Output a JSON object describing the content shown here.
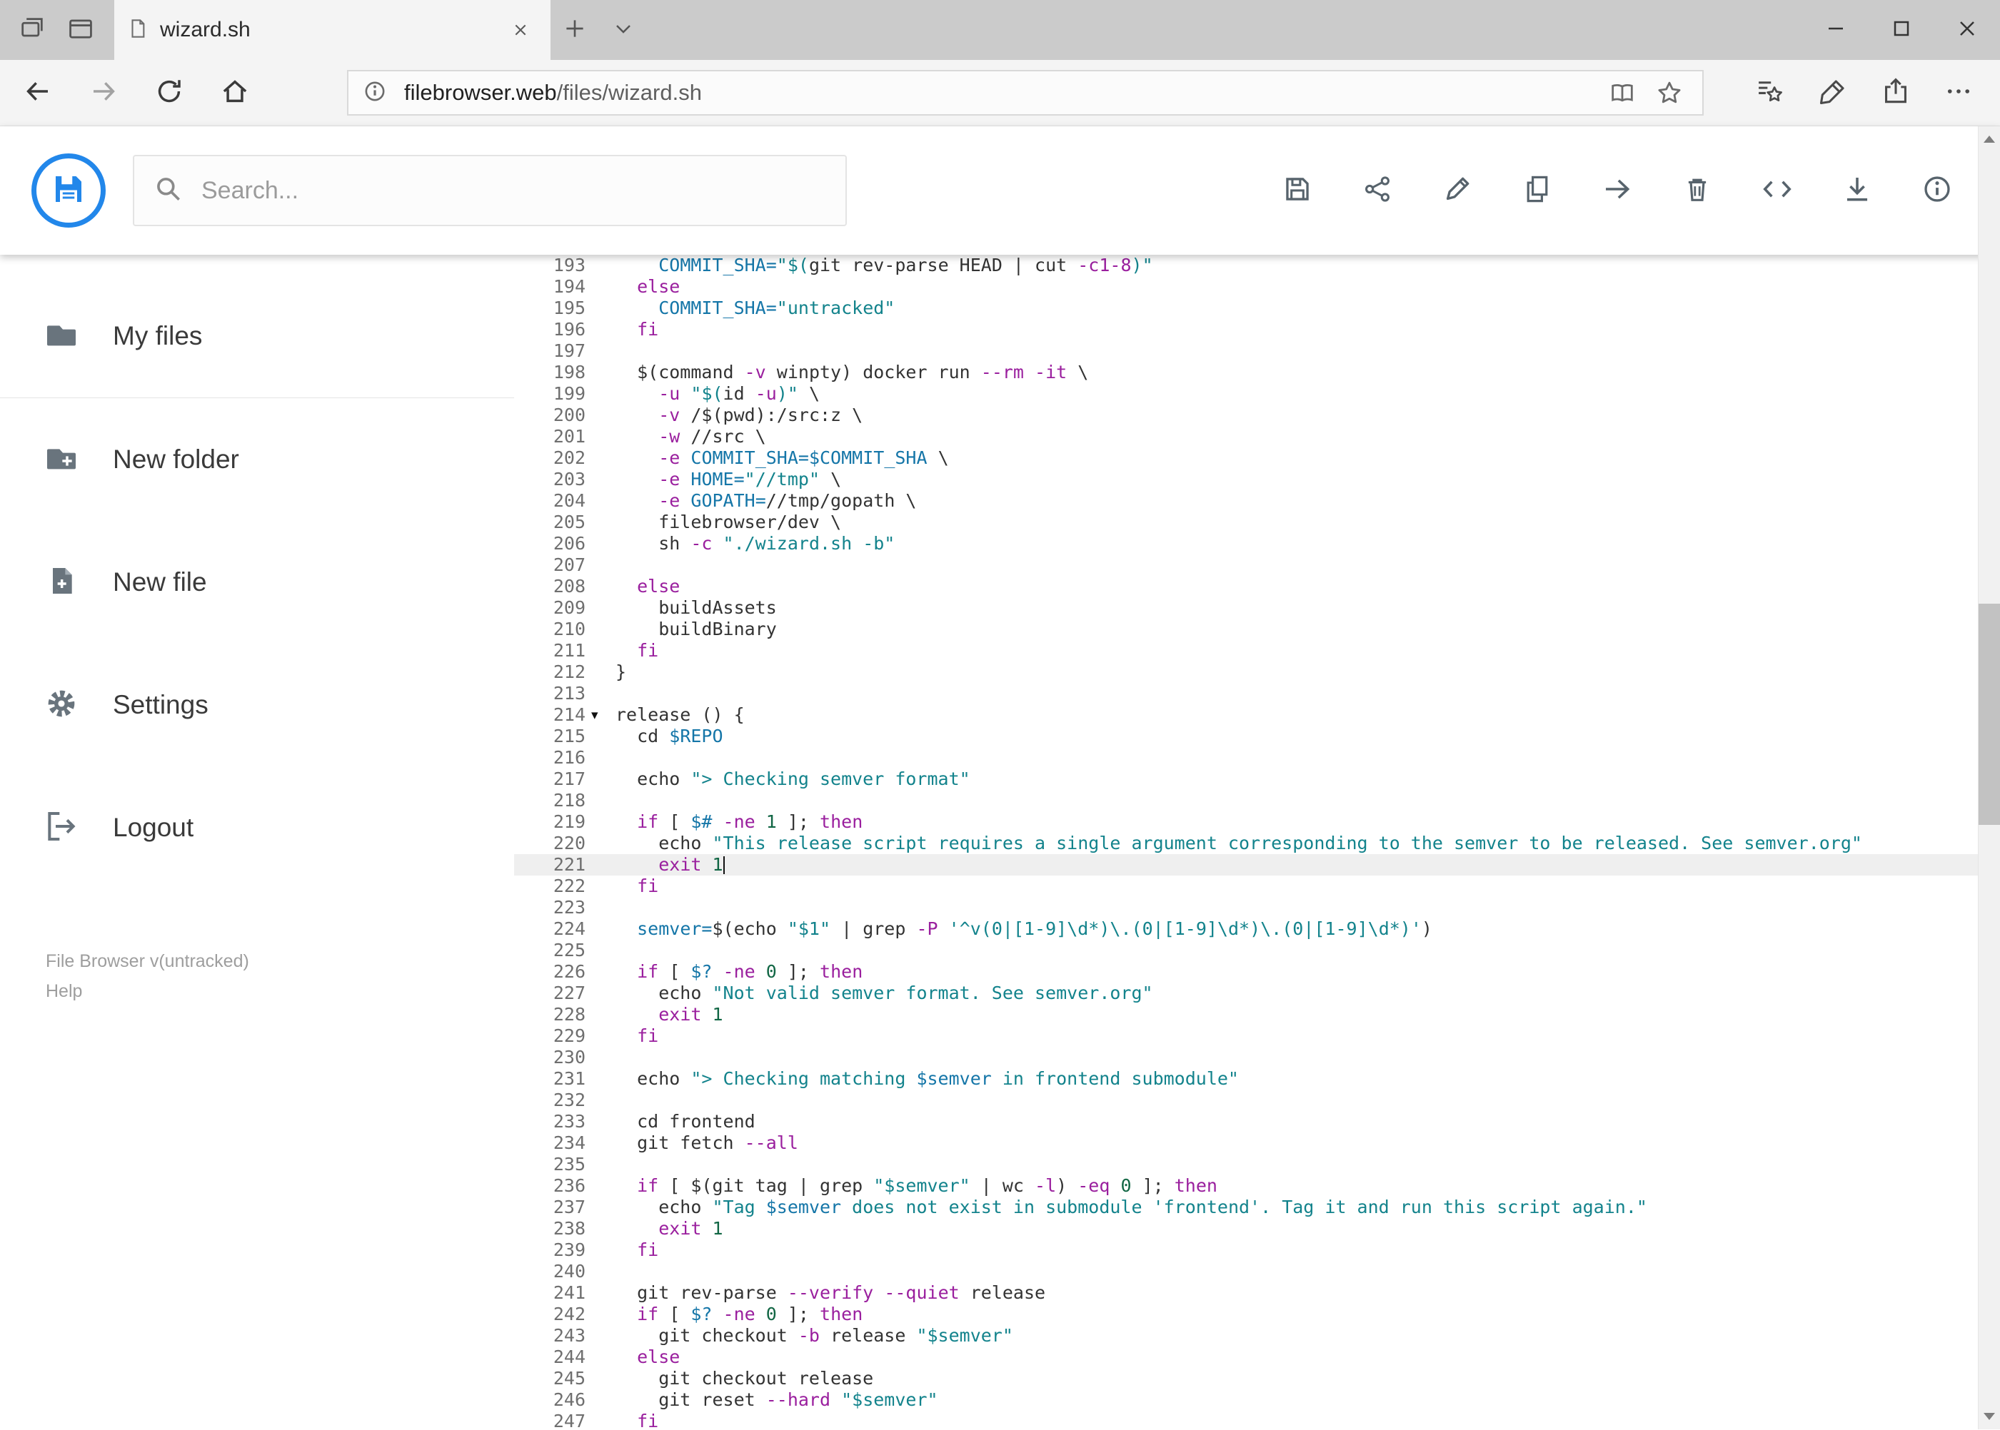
{
  "browser": {
    "tab_title": "wizard.sh",
    "url_domain": "filebrowser.web",
    "url_path": "/files/wizard.sh"
  },
  "header": {
    "search_placeholder": "Search..."
  },
  "sidebar": {
    "items": [
      {
        "label": "My files"
      },
      {
        "label": "New folder"
      },
      {
        "label": "New file"
      },
      {
        "label": "Settings"
      },
      {
        "label": "Logout"
      }
    ],
    "credits_title": "File Browser v(untracked)",
    "credits_help": "Help"
  },
  "colors": {
    "accent_blue": "#2287ea",
    "keyword": "#9a1f9e",
    "variable": "#1576a8",
    "string": "#13838c",
    "number": "#116644",
    "plain_code": "#333333",
    "active_line_bg": "#efefef"
  },
  "icons": {
    "toolbar": [
      "save-icon",
      "share-icon",
      "rename-icon",
      "copy-icon",
      "move-icon",
      "delete-icon",
      "code-icon",
      "download-icon",
      "info-icon"
    ],
    "sidebar": [
      "folder-icon",
      "new-folder-icon",
      "new-file-icon",
      "settings-icon",
      "logout-icon"
    ],
    "navbar": [
      "back-icon",
      "forward-icon",
      "refresh-icon",
      "home-icon",
      "info-circle-icon",
      "reading-view-icon",
      "star-icon",
      "hub-icon",
      "web-note-icon",
      "share-icon",
      "more-icon"
    ]
  },
  "editor": {
    "fold_marker": "▾",
    "active_line": 221,
    "lines": [
      {
        "n": 193,
        "t": [
          [
            "p",
            "    "
          ],
          [
            "v",
            "COMMIT_SHA="
          ],
          [
            "s",
            "\"$("
          ],
          [
            "p",
            "git rev-parse HEAD | cut "
          ],
          [
            "k",
            "-c1-8"
          ],
          [
            "s",
            ")\""
          ]
        ]
      },
      {
        "n": 194,
        "t": [
          [
            "p",
            "  "
          ],
          [
            "k",
            "else"
          ]
        ]
      },
      {
        "n": 195,
        "t": [
          [
            "p",
            "    "
          ],
          [
            "v",
            "COMMIT_SHA="
          ],
          [
            "s",
            "\"untracked\""
          ]
        ]
      },
      {
        "n": 196,
        "t": [
          [
            "p",
            "  "
          ],
          [
            "k",
            "fi"
          ]
        ]
      },
      {
        "n": 197,
        "t": [
          [
            "p",
            ""
          ]
        ]
      },
      {
        "n": 198,
        "t": [
          [
            "p",
            "  $(command "
          ],
          [
            "k",
            "-v"
          ],
          [
            "p",
            " winpty) docker run "
          ],
          [
            "k",
            "--rm"
          ],
          [
            "p",
            " "
          ],
          [
            "k",
            "-it"
          ],
          [
            "p",
            " \\"
          ]
        ]
      },
      {
        "n": 199,
        "t": [
          [
            "p",
            "    "
          ],
          [
            "k",
            "-u"
          ],
          [
            "p",
            " "
          ],
          [
            "s",
            "\"$("
          ],
          [
            "p",
            "id "
          ],
          [
            "k",
            "-u"
          ],
          [
            "s",
            ")\""
          ],
          [
            "p",
            " \\"
          ]
        ]
      },
      {
        "n": 200,
        "t": [
          [
            "p",
            "    "
          ],
          [
            "k",
            "-v"
          ],
          [
            "p",
            " /$(pwd):/src:z \\"
          ]
        ]
      },
      {
        "n": 201,
        "t": [
          [
            "p",
            "    "
          ],
          [
            "k",
            "-w"
          ],
          [
            "p",
            " //src \\"
          ]
        ]
      },
      {
        "n": 202,
        "t": [
          [
            "p",
            "    "
          ],
          [
            "k",
            "-e"
          ],
          [
            "p",
            " "
          ],
          [
            "v",
            "COMMIT_SHA=$COMMIT_SHA"
          ],
          [
            "p",
            " \\"
          ]
        ]
      },
      {
        "n": 203,
        "t": [
          [
            "p",
            "    "
          ],
          [
            "k",
            "-e"
          ],
          [
            "p",
            " "
          ],
          [
            "v",
            "HOME="
          ],
          [
            "s",
            "\"//tmp\""
          ],
          [
            "p",
            " \\"
          ]
        ]
      },
      {
        "n": 204,
        "t": [
          [
            "p",
            "    "
          ],
          [
            "k",
            "-e"
          ],
          [
            "p",
            " "
          ],
          [
            "v",
            "GOPATH="
          ],
          [
            "p",
            "//tmp/gopath \\"
          ]
        ]
      },
      {
        "n": 205,
        "t": [
          [
            "p",
            "    filebrowser/dev \\"
          ]
        ]
      },
      {
        "n": 206,
        "t": [
          [
            "p",
            "    sh "
          ],
          [
            "k",
            "-c"
          ],
          [
            "p",
            " "
          ],
          [
            "s",
            "\"./wizard.sh -b\""
          ]
        ]
      },
      {
        "n": 207,
        "t": [
          [
            "p",
            ""
          ]
        ]
      },
      {
        "n": 208,
        "t": [
          [
            "p",
            "  "
          ],
          [
            "k",
            "else"
          ]
        ]
      },
      {
        "n": 209,
        "t": [
          [
            "p",
            "    buildAssets"
          ]
        ]
      },
      {
        "n": 210,
        "t": [
          [
            "p",
            "    buildBinary"
          ]
        ]
      },
      {
        "n": 211,
        "t": [
          [
            "p",
            "  "
          ],
          [
            "k",
            "fi"
          ]
        ]
      },
      {
        "n": 212,
        "t": [
          [
            "p",
            "}"
          ]
        ]
      },
      {
        "n": 213,
        "t": [
          [
            "p",
            ""
          ]
        ]
      },
      {
        "n": 214,
        "fold": true,
        "t": [
          [
            "p",
            "release () {"
          ]
        ]
      },
      {
        "n": 215,
        "t": [
          [
            "p",
            "  cd "
          ],
          [
            "v",
            "$REPO"
          ]
        ]
      },
      {
        "n": 216,
        "t": [
          [
            "p",
            ""
          ]
        ]
      },
      {
        "n": 217,
        "t": [
          [
            "p",
            "  echo "
          ],
          [
            "s",
            "\"> Checking semver format\""
          ]
        ]
      },
      {
        "n": 218,
        "t": [
          [
            "p",
            ""
          ]
        ]
      },
      {
        "n": 219,
        "t": [
          [
            "p",
            "  "
          ],
          [
            "k",
            "if"
          ],
          [
            "p",
            " [ "
          ],
          [
            "v",
            "$#"
          ],
          [
            "p",
            " "
          ],
          [
            "k",
            "-ne"
          ],
          [
            "p",
            " "
          ],
          [
            "n",
            "1"
          ],
          [
            "p",
            " ]; "
          ],
          [
            "k",
            "then"
          ]
        ]
      },
      {
        "n": 220,
        "t": [
          [
            "p",
            "    echo "
          ],
          [
            "s",
            "\"This release script requires a single argument corresponding to the semver to be released. See semver.org\""
          ]
        ]
      },
      {
        "n": 221,
        "active": true,
        "cursor": true,
        "t": [
          [
            "p",
            "    "
          ],
          [
            "k",
            "exit"
          ],
          [
            "p",
            " "
          ],
          [
            "n",
            "1"
          ]
        ]
      },
      {
        "n": 222,
        "t": [
          [
            "p",
            "  "
          ],
          [
            "k",
            "fi"
          ]
        ]
      },
      {
        "n": 223,
        "t": [
          [
            "p",
            ""
          ]
        ]
      },
      {
        "n": 224,
        "t": [
          [
            "p",
            "  "
          ],
          [
            "v",
            "semver="
          ],
          [
            "p",
            "$(echo "
          ],
          [
            "s",
            "\"$1\""
          ],
          [
            "p",
            " | grep "
          ],
          [
            "k",
            "-P"
          ],
          [
            "p",
            " "
          ],
          [
            "s",
            "'^v(0|[1-9]\\d*)\\.(0|[1-9]\\d*)\\.(0|[1-9]\\d*)'"
          ],
          [
            "p",
            ")"
          ]
        ]
      },
      {
        "n": 225,
        "t": [
          [
            "p",
            ""
          ]
        ]
      },
      {
        "n": 226,
        "t": [
          [
            "p",
            "  "
          ],
          [
            "k",
            "if"
          ],
          [
            "p",
            " [ "
          ],
          [
            "v",
            "$?"
          ],
          [
            "p",
            " "
          ],
          [
            "k",
            "-ne"
          ],
          [
            "p",
            " "
          ],
          [
            "n",
            "0"
          ],
          [
            "p",
            " ]; "
          ],
          [
            "k",
            "then"
          ]
        ]
      },
      {
        "n": 227,
        "t": [
          [
            "p",
            "    echo "
          ],
          [
            "s",
            "\"Not valid semver format. See semver.org\""
          ]
        ]
      },
      {
        "n": 228,
        "t": [
          [
            "p",
            "    "
          ],
          [
            "k",
            "exit"
          ],
          [
            "p",
            " "
          ],
          [
            "n",
            "1"
          ]
        ]
      },
      {
        "n": 229,
        "t": [
          [
            "p",
            "  "
          ],
          [
            "k",
            "fi"
          ]
        ]
      },
      {
        "n": 230,
        "t": [
          [
            "p",
            ""
          ]
        ]
      },
      {
        "n": 231,
        "t": [
          [
            "p",
            "  echo "
          ],
          [
            "s",
            "\"> Checking matching "
          ],
          [
            "v",
            "$semver"
          ],
          [
            "s",
            " in frontend submodule\""
          ]
        ]
      },
      {
        "n": 232,
        "t": [
          [
            "p",
            ""
          ]
        ]
      },
      {
        "n": 233,
        "t": [
          [
            "p",
            "  cd frontend"
          ]
        ]
      },
      {
        "n": 234,
        "t": [
          [
            "p",
            "  git fetch "
          ],
          [
            "k",
            "--all"
          ]
        ]
      },
      {
        "n": 235,
        "t": [
          [
            "p",
            ""
          ]
        ]
      },
      {
        "n": 236,
        "t": [
          [
            "p",
            "  "
          ],
          [
            "k",
            "if"
          ],
          [
            "p",
            " [ $(git tag | grep "
          ],
          [
            "s",
            "\"$semver\""
          ],
          [
            "p",
            " | wc "
          ],
          [
            "k",
            "-l"
          ],
          [
            "p",
            ") "
          ],
          [
            "k",
            "-eq"
          ],
          [
            "p",
            " "
          ],
          [
            "n",
            "0"
          ],
          [
            "p",
            " ]; "
          ],
          [
            "k",
            "then"
          ]
        ]
      },
      {
        "n": 237,
        "t": [
          [
            "p",
            "    echo "
          ],
          [
            "s",
            "\"Tag "
          ],
          [
            "v",
            "$semver"
          ],
          [
            "s",
            " does not exist in submodule 'frontend'. Tag it and run this script again.\""
          ]
        ]
      },
      {
        "n": 238,
        "t": [
          [
            "p",
            "    "
          ],
          [
            "k",
            "exit"
          ],
          [
            "p",
            " "
          ],
          [
            "n",
            "1"
          ]
        ]
      },
      {
        "n": 239,
        "t": [
          [
            "p",
            "  "
          ],
          [
            "k",
            "fi"
          ]
        ]
      },
      {
        "n": 240,
        "t": [
          [
            "p",
            ""
          ]
        ]
      },
      {
        "n": 241,
        "t": [
          [
            "p",
            "  git rev-parse "
          ],
          [
            "k",
            "--verify"
          ],
          [
            "p",
            " "
          ],
          [
            "k",
            "--quiet"
          ],
          [
            "p",
            " release"
          ]
        ]
      },
      {
        "n": 242,
        "t": [
          [
            "p",
            "  "
          ],
          [
            "k",
            "if"
          ],
          [
            "p",
            " [ "
          ],
          [
            "v",
            "$?"
          ],
          [
            "p",
            " "
          ],
          [
            "k",
            "-ne"
          ],
          [
            "p",
            " "
          ],
          [
            "n",
            "0"
          ],
          [
            "p",
            " ]; "
          ],
          [
            "k",
            "then"
          ]
        ]
      },
      {
        "n": 243,
        "t": [
          [
            "p",
            "    git checkout "
          ],
          [
            "k",
            "-b"
          ],
          [
            "p",
            " release "
          ],
          [
            "s",
            "\"$semver\""
          ]
        ]
      },
      {
        "n": 244,
        "t": [
          [
            "p",
            "  "
          ],
          [
            "k",
            "else"
          ]
        ]
      },
      {
        "n": 245,
        "t": [
          [
            "p",
            "    git checkout release"
          ]
        ]
      },
      {
        "n": 246,
        "t": [
          [
            "p",
            "    git reset "
          ],
          [
            "k",
            "--hard"
          ],
          [
            "p",
            " "
          ],
          [
            "s",
            "\"$semver\""
          ]
        ]
      },
      {
        "n": 247,
        "t": [
          [
            "p",
            "  "
          ],
          [
            "k",
            "fi"
          ]
        ]
      }
    ]
  }
}
